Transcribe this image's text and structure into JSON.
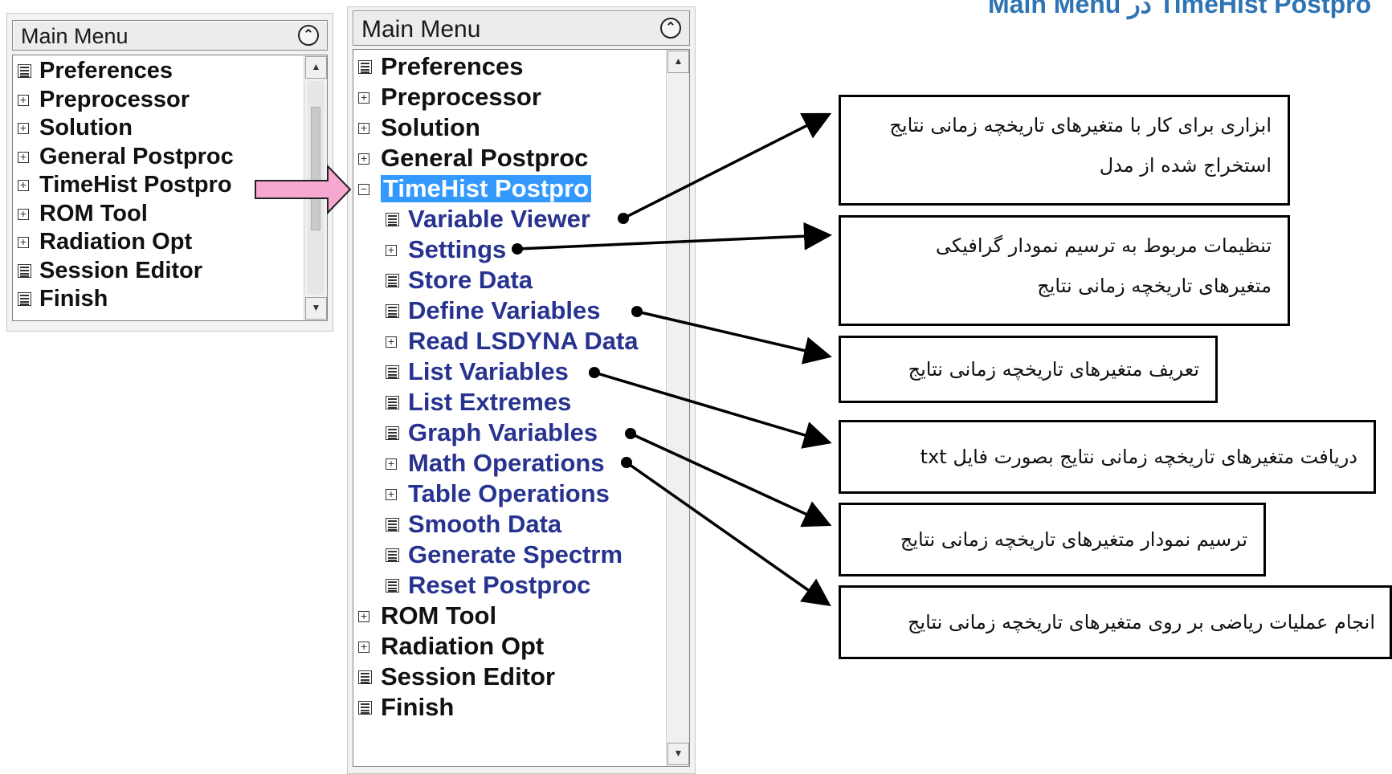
{
  "page_heading": "Main Menu در TimeHist Postpro",
  "left_panel": {
    "title": "Main Menu",
    "collapse_icon": "double-chevron-up-icon",
    "items": [
      {
        "label": "Preferences",
        "icon": "page-icon"
      },
      {
        "label": "Preprocessor",
        "icon": "plus-box-icon"
      },
      {
        "label": "Solution",
        "icon": "plus-box-icon"
      },
      {
        "label": "General Postproc",
        "icon": "plus-box-icon"
      },
      {
        "label": "TimeHist Postpro",
        "icon": "plus-box-icon"
      },
      {
        "label": "ROM Tool",
        "icon": "plus-box-icon"
      },
      {
        "label": "Radiation Opt",
        "icon": "plus-box-icon"
      },
      {
        "label": "Session Editor",
        "icon": "page-icon"
      },
      {
        "label": "Finish",
        "icon": "page-icon"
      }
    ]
  },
  "right_panel": {
    "title": "Main Menu",
    "collapse_icon": "double-chevron-up-icon",
    "items": [
      {
        "label": "Preferences",
        "icon": "page-icon"
      },
      {
        "label": "Preprocessor",
        "icon": "plus-box-icon"
      },
      {
        "label": "Solution",
        "icon": "plus-box-icon"
      },
      {
        "label": "General Postproc",
        "icon": "plus-box-icon"
      },
      {
        "label": "TimeHist Postpro",
        "icon": "minus-box-icon"
      },
      {
        "label": "Variable Viewer",
        "icon": "page-icon"
      },
      {
        "label": "Settings",
        "icon": "plus-box-icon"
      },
      {
        "label": "Store Data",
        "icon": "page-icon"
      },
      {
        "label": "Define Variables",
        "icon": "page-icon"
      },
      {
        "label": "Read LSDYNA Data",
        "icon": "plus-box-icon"
      },
      {
        "label": "List Variables",
        "icon": "page-icon"
      },
      {
        "label": "List Extremes",
        "icon": "page-icon"
      },
      {
        "label": "Graph Variables",
        "icon": "page-icon"
      },
      {
        "label": "Math Operations",
        "icon": "plus-box-icon"
      },
      {
        "label": "Table Operations",
        "icon": "plus-box-icon"
      },
      {
        "label": "Smooth Data",
        "icon": "page-icon"
      },
      {
        "label": "Generate Spectrm",
        "icon": "page-icon"
      },
      {
        "label": "Reset Postproc",
        "icon": "page-icon"
      },
      {
        "label": "ROM Tool",
        "icon": "plus-box-icon"
      },
      {
        "label": "Radiation Opt",
        "icon": "plus-box-icon"
      },
      {
        "label": "Session Editor",
        "icon": "page-icon"
      },
      {
        "label": "Finish",
        "icon": "page-icon"
      }
    ]
  },
  "annotations": [
    {
      "lines": [
        "ابزاری برای کار با متغیرهای تاریخچه زمانی نتایج",
        "استخراج شده از مدل"
      ]
    },
    {
      "lines": [
        "تنظیمات مربوط به ترسیم نمودار گرافیکی",
        "متغیرهای تاریخچه زمانی نتایج"
      ]
    },
    {
      "lines": [
        "تعریف متغیرهای تاریخچه زمانی نتایج"
      ]
    },
    {
      "lines": [
        "دریافت متغیرهای تاریخچه زمانی نتایج بصورت فایل txt"
      ]
    },
    {
      "lines": [
        "ترسیم نمودار متغیرهای تاریخچه زمانی نتایج"
      ]
    },
    {
      "lines": [
        "انجام عملیات ریاضی بر روی متغیرهای تاریخچه زمانی نتایج"
      ]
    }
  ],
  "colors": {
    "heading": "#2e74b5",
    "submenu_text": "#27338f",
    "selection": "#3399ff",
    "pointer_arrow": "#f7a8d1"
  }
}
